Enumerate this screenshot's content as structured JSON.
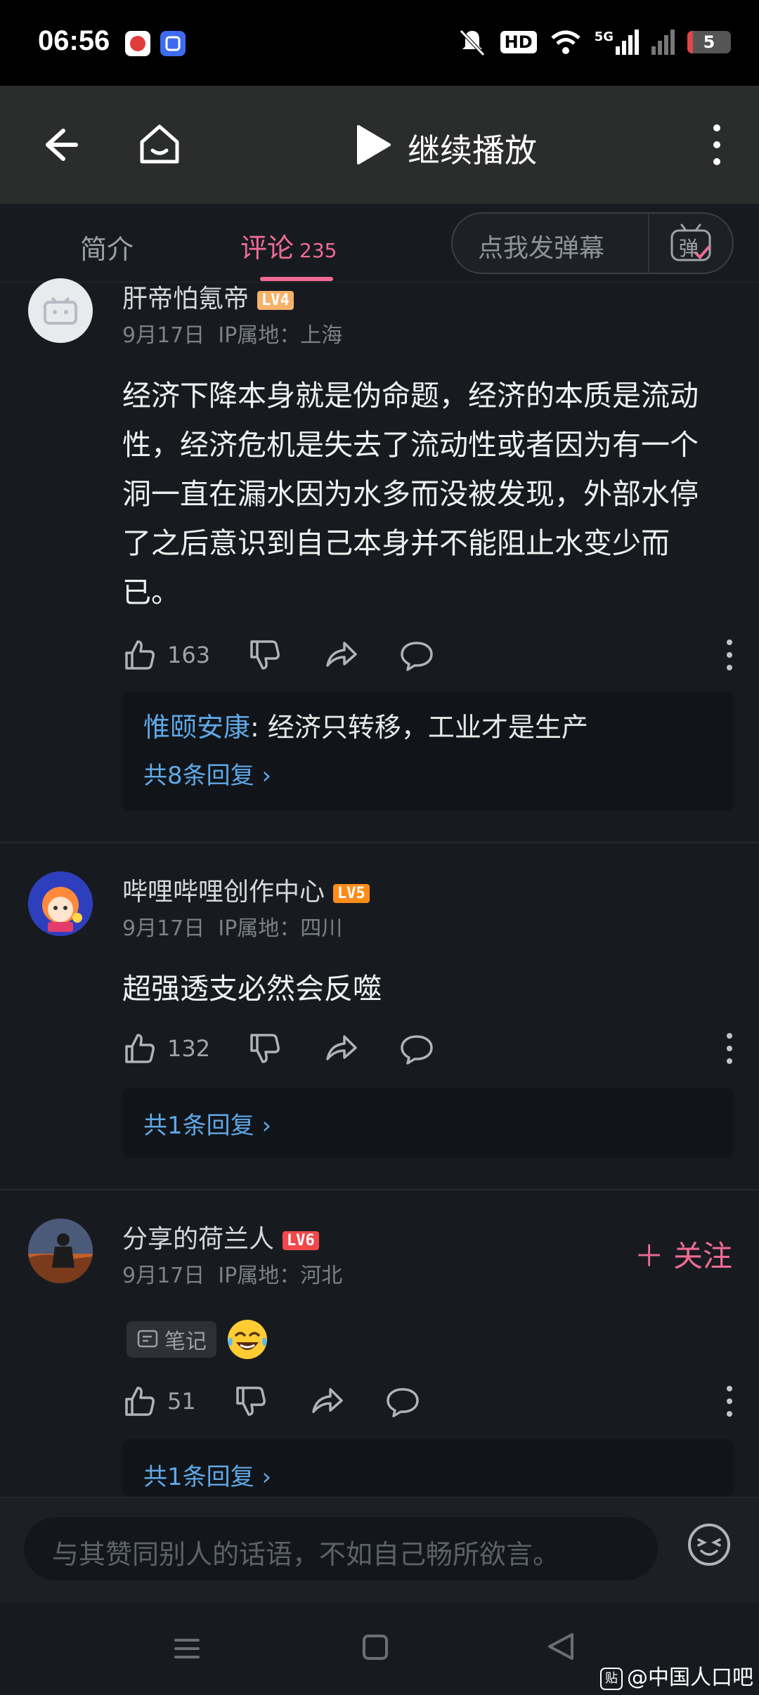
{
  "status_bar": {
    "time": "06:56",
    "battery": "5",
    "network": "5G",
    "hd": "HD"
  },
  "nav": {
    "title": "继续播放"
  },
  "tabs": {
    "intro": "简介",
    "comments": "评论",
    "comments_count": "235",
    "danmu_placeholder": "点我发弹幕",
    "danmu_icon_char": "弹"
  },
  "comments": [
    {
      "username": "肝帝怕氪帝",
      "level": "LV4",
      "level_color": "#f6b26b",
      "date": "9月17日",
      "ip": "IP属地：上海",
      "content": "经济下降本身就是伪命题，经济的本质是流动性，经济危机是失去了流动性或者因为有一个洞一直在漏水因为水多而没被发现，外部水停了之后意识到自己本身并不能阻止水变少而已。",
      "likes": "163",
      "reply_preview_name": "惟颐安康",
      "reply_preview_text": ": 经济只转移，工业才是生产",
      "reply_count_text": "共8条回复 ›"
    },
    {
      "username": "哔哩哔哩创作中心",
      "level": "LV5",
      "level_color": "#ff8c1a",
      "date": "9月17日",
      "ip": "IP属地：四川",
      "content": "超强透支必然会反噬",
      "likes": "132",
      "reply_count_text": "共1条回复 ›"
    },
    {
      "username": "分享的荷兰人",
      "level": "LV6",
      "level_color": "#f0484b",
      "date": "9月17日",
      "ip": "IP属地：河北",
      "follow": "＋ 关注",
      "note_tag": "笔记",
      "likes": "51",
      "reply_count_text": "共1条回复 ›"
    }
  ],
  "input": {
    "placeholder": "与其赞同别人的话语，不如自己畅所欲言。"
  },
  "watermark": {
    "badge": "贴",
    "text": "@中国人口吧"
  }
}
